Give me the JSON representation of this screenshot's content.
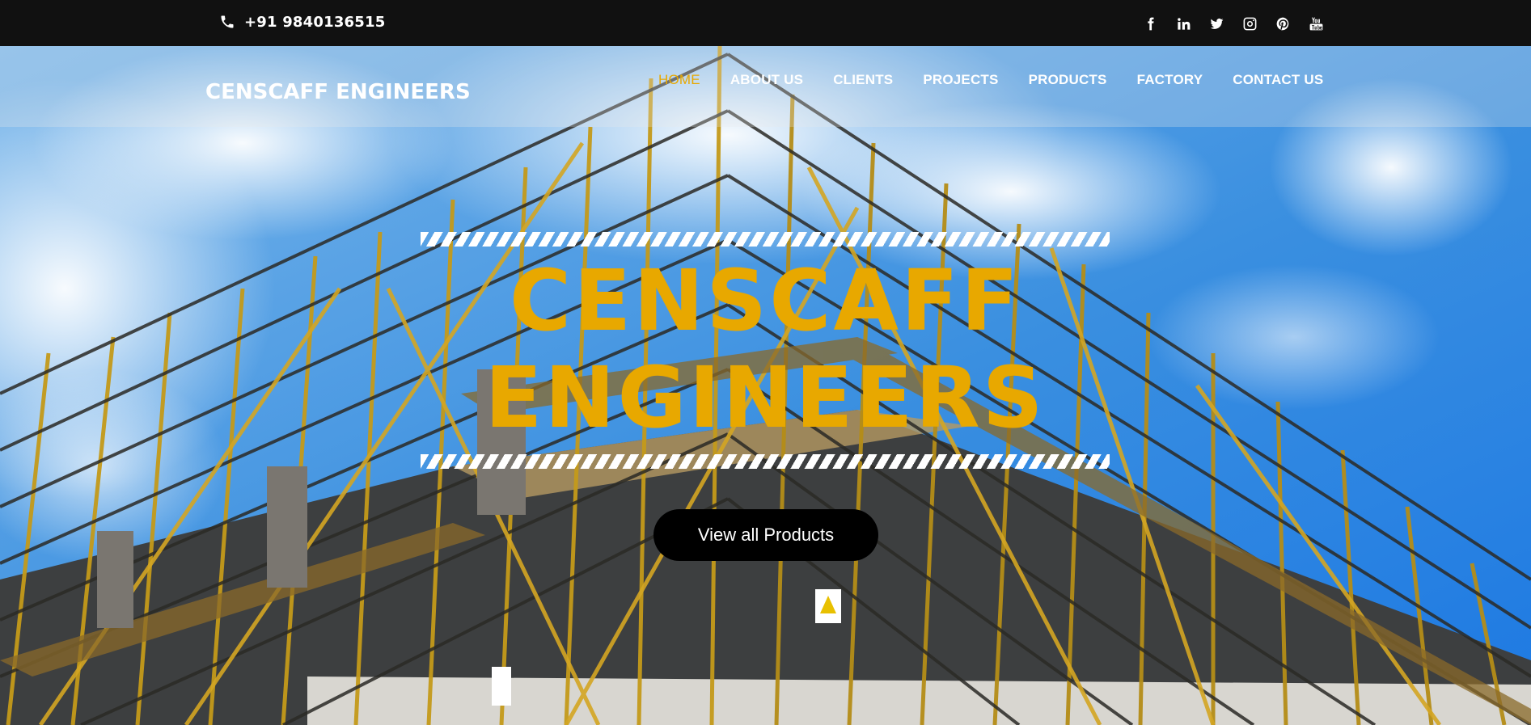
{
  "topbar": {
    "phone": "+91 9840136515",
    "social_icons": [
      "facebook-icon",
      "linkedin-icon",
      "twitter-icon",
      "instagram-icon",
      "pinterest-icon",
      "youtube-icon"
    ]
  },
  "header": {
    "brand": "CENSCAFF ENGINEERS",
    "nav": [
      {
        "label": "HOME",
        "active": true
      },
      {
        "label": "ABOUT US",
        "active": false
      },
      {
        "label": "CLIENTS",
        "active": false
      },
      {
        "label": "PROJECTS",
        "active": false
      },
      {
        "label": "PRODUCTS",
        "active": false
      },
      {
        "label": "FACTORY",
        "active": false
      },
      {
        "label": "CONTACT US",
        "active": false
      }
    ]
  },
  "hero": {
    "title_line1": "CENSCAFF",
    "title_line2": "ENGINEERS",
    "cta_label": "View all Products",
    "accent_color": "#e8a800",
    "background_image": "scaffolding-building-photo"
  }
}
